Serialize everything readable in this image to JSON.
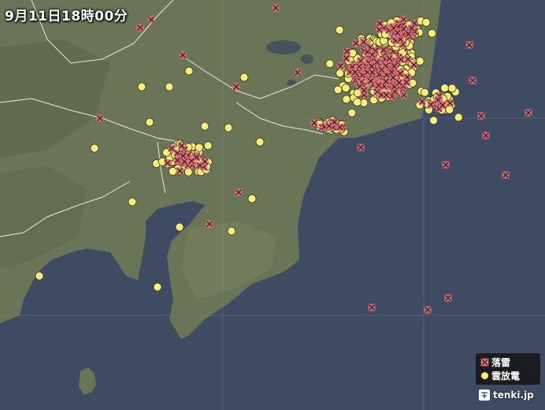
{
  "timestamp": "9月11日18時00分",
  "legend": {
    "strike_label": "落雷",
    "cloud_label": "雲放電",
    "strike_color": "#ef6d77",
    "cloud_color": "#f7ef78"
  },
  "brand": "tenki.jp",
  "colors": {
    "sea": "#3f4a63",
    "land": "#6b7558",
    "grid": "#7d8aa0",
    "border": "#e8e8e8"
  },
  "icons": {
    "strike": "x-cross-icon",
    "cloud": "circle-dot-icon",
    "brand": "tenki-logo-icon"
  }
}
